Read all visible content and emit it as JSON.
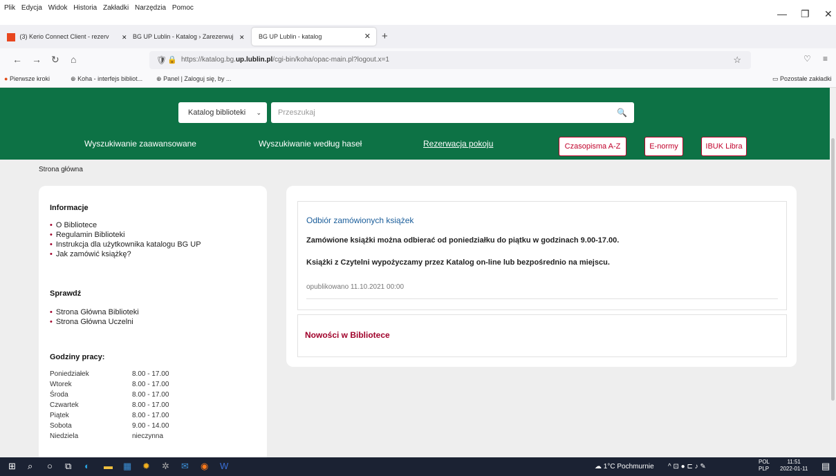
{
  "browser": {
    "menu": [
      "Plik",
      "Edycja",
      "Widok",
      "Historia",
      "Zakładki",
      "Narzędzia",
      "Pomoc"
    ],
    "tabs": [
      {
        "label": "(3) Kerio Connect Client - rezerv",
        "active": false
      },
      {
        "label": "BG UP Lublin - Katalog › Zarezerwuj",
        "active": false
      },
      {
        "label": "BG UP Lublin - katalog",
        "active": true
      }
    ],
    "url_prefix": "https://katalog.bg.",
    "url_domain": "up.lublin.pl",
    "url_path": "/cgi-bin/koha/opac-main.pl?logout.x=1",
    "bookmarks": [
      "Pierwsze kroki",
      "Koha - interfejs bibliot...",
      "Panel | Zaloguj się, by ..."
    ],
    "other_bookmarks": "Pozostałe zakładki"
  },
  "header": {
    "select_value": "Katalog biblioteki",
    "search_placeholder": "Przeszukaj",
    "links": {
      "advanced": "Wyszukiwanie zaawansowane",
      "by_term": "Wyszukiwanie według haseł",
      "room": "Rezerwacja pokoju"
    },
    "buttons": {
      "czasopisma": "Czasopisma A-Z",
      "enormy": "E-normy",
      "ibuk": "IBUK Libra"
    }
  },
  "breadcrumb": "Strona główna",
  "sidebar": {
    "info_heading": "Informacje",
    "info_links": [
      "O Bibliotece",
      "Regulamin Biblioteki",
      "Instrukcja dla użytkownika katalogu BG UP",
      "Jak zamówić książkę?"
    ],
    "check_heading": "Sprawdź",
    "check_links": [
      "Strona Główna Biblioteki",
      "Strona Główna Uczelni"
    ],
    "hours_heading": "Godziny pracy:",
    "hours": [
      {
        "day": "Poniedziałek",
        "time": "8.00 - 17.00"
      },
      {
        "day": "Wtorek",
        "time": "8.00 - 17.00"
      },
      {
        "day": "Środa",
        "time": "8.00 - 17.00"
      },
      {
        "day": "Czwartek",
        "time": "8.00 - 17.00"
      },
      {
        "day": "Piątek",
        "time": "8.00 - 17.00"
      },
      {
        "day": "Sobota",
        "time": "9.00 - 14.00"
      },
      {
        "day": "Niedziela",
        "time": "nieczynna"
      }
    ]
  },
  "news": {
    "title": "Odbiór zamówionych książek",
    "p1": "Zamówione książki można odbierać od poniedziałku do piątku w godzinach 9.00-17.00.",
    "p2": "Książki z Czytelni wypożyczamy przez Katalog on-line lub bezpośrednio na miejscu.",
    "date": "opublikowano 11.10.2021 00:00",
    "news2_title": "Nowości w Bibliotece"
  },
  "taskbar": {
    "weather": "1°C Pochmurnie",
    "lang1": "POL",
    "lang2": "PLP",
    "time": "11:51",
    "date": "2022-01-11"
  }
}
